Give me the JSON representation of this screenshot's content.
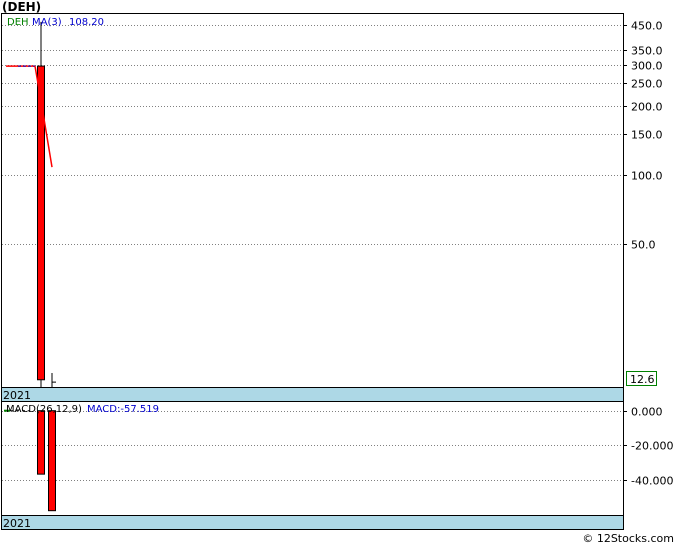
{
  "title": "(DEH)",
  "credit": "© 12Stocks.com",
  "chart_data": [
    {
      "type": "candlestick",
      "name": "price-panel",
      "legend": {
        "symbol": "DEH",
        "ma_label": "MA(3)",
        "ma_value": "108.20"
      },
      "y_scale": "log",
      "ylim": [
        12.0,
        500.0
      ],
      "y_ticks": [
        "450.0",
        "350.0",
        "300.0",
        "250.0",
        "200.0",
        "150.0",
        "100.0",
        "50.0"
      ],
      "last_price_label": "12.6",
      "x_label": "2021",
      "candles": [
        {
          "open": 297,
          "high": 462,
          "low": 12.0,
          "close": 12.9,
          "color": "red"
        },
        {
          "open": 12.6,
          "high": 13.8,
          "low": 12.0,
          "close": 12.6,
          "color": "black"
        }
      ],
      "pre_line": {
        "value": 297
      },
      "ma_line": [
        297,
        210,
        108.2
      ],
      "colors": {
        "down": "#ff0000",
        "axis_strip": "#add8e6",
        "grid": "#808080",
        "ma": "#ff0000"
      }
    },
    {
      "type": "bar",
      "name": "macd-panel",
      "legend": {
        "label": "MACD(26,12,9)",
        "value_label": "MACD:-57.519"
      },
      "ylim": [
        -60.0,
        5.0
      ],
      "y_ticks": [
        "0.000",
        "-20.000",
        "-40.000"
      ],
      "x_label": "2021",
      "values": [
        -36.5,
        -57.519
      ],
      "colors": {
        "bar": "#ff0000",
        "axis_strip": "#add8e6",
        "grid": "#808080"
      }
    }
  ]
}
